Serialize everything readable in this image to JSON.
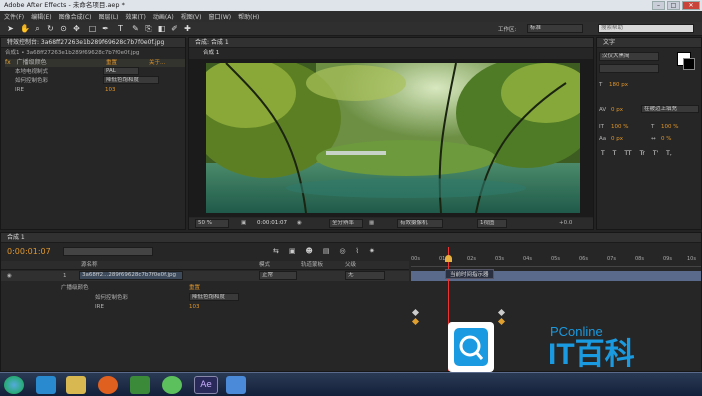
{
  "window": {
    "title": "Adobe After Effects - 未命名项目.aep *",
    "btn_min": "–",
    "btn_max": "□",
    "btn_close": "✕"
  },
  "menu": [
    "文件(F)",
    "编辑(E)",
    "图像合成(C)",
    "图层(L)",
    "效果(T)",
    "动画(A)",
    "视图(V)",
    "窗口(W)",
    "帮助(H)"
  ],
  "toolbar": {
    "workspace_label": "工作区:",
    "workspace_value": "标准",
    "search_placeholder": "搜索帮助"
  },
  "effect_controls": {
    "tab": "特效控制台: 3a68ff27263e1b289f69628c7b7f0e0f.jpg",
    "layer_path": "合成1 • 3a68ff27263e1b289f69628c7b7f0e0f.jpg",
    "effect_name": "广播级颜色",
    "reset": "重置",
    "about": "关于...",
    "props": [
      {
        "name": "本地电视制式",
        "value": "PAL"
      },
      {
        "name": "如何控制色彩",
        "value": "降低色饱和度"
      },
      {
        "name": "IRE",
        "value": "103"
      }
    ]
  },
  "composition": {
    "tab": "合成: 合成 1",
    "subtab": "合成 1",
    "zoom": "50 %",
    "timecode": "0:00:01:07",
    "quality": "全分辨率",
    "camera": "有效摄像机",
    "view": "1视图",
    "exposure": "+0.0"
  },
  "character": {
    "tab": "文字",
    "font": "汉仪大黑简",
    "style": "",
    "size": "180 px",
    "tracking": "0 px",
    "leading_mode": "在被边上填充",
    "scale_v": "100 %",
    "scale_h": "100 %",
    "baseline": "0 px",
    "tsume": "0 %",
    "format_buttons": [
      "T",
      "T",
      "TT",
      "Tr",
      "T'",
      "T,"
    ]
  },
  "timeline": {
    "tab": "合成 1",
    "timecode": "0:00:01:07",
    "ticks": [
      "00s",
      "01s",
      "02s",
      "03s",
      "04s",
      "05s",
      "06s",
      "07s",
      "08s",
      "09s",
      "10s"
    ],
    "tooltip": "当前时间指示器",
    "columns": {
      "source": "源名称",
      "mode": "模式",
      "trkmat": "轨道蒙板",
      "parent": "父级"
    },
    "layer": {
      "num": "1",
      "name": "3a68ff2...289f69628c7b7f0e0f.jpg",
      "mode": "正常",
      "parent": "无"
    },
    "effect_rows": [
      {
        "name": "广播级颜色",
        "value": "重置"
      },
      {
        "name": "如何控制色彩",
        "value": "降低色饱和度"
      },
      {
        "name": "IRE",
        "value": "103"
      }
    ]
  },
  "watermark": {
    "brand": "PConline",
    "text": "IT百科"
  },
  "taskbar": {
    "ae_label": "Ae"
  }
}
